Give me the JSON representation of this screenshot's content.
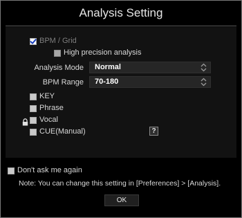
{
  "dialog": {
    "title": "Analysis Setting"
  },
  "options": {
    "bpm_grid": {
      "label": "BPM / Grid",
      "checked": true,
      "enabled": false
    },
    "high_precision": {
      "label": "High precision analysis",
      "checked": false,
      "enabled": false
    },
    "analysis_mode": {
      "label": "Analysis Mode",
      "value": "Normal"
    },
    "bpm_range": {
      "label": "BPM Range",
      "value": "70-180"
    },
    "key": {
      "label": "KEY",
      "checked": false
    },
    "phrase": {
      "label": "Phrase",
      "checked": false
    },
    "vocal": {
      "label": "Vocal",
      "checked": false,
      "locked_icon": "lock-icon"
    },
    "cue_manual": {
      "label": "CUE(Manual)",
      "checked": false,
      "help_label": "?"
    }
  },
  "footer": {
    "dont_ask": {
      "label": "Don't ask me again",
      "checked": false
    },
    "note": "Note: You can change this setting in [Preferences] > [Analysis].",
    "ok_label": "OK"
  },
  "colors": {
    "background": "#000000",
    "panel": "#121212",
    "text": "#d8d8d8",
    "check_accent": "#1a3fbf"
  }
}
